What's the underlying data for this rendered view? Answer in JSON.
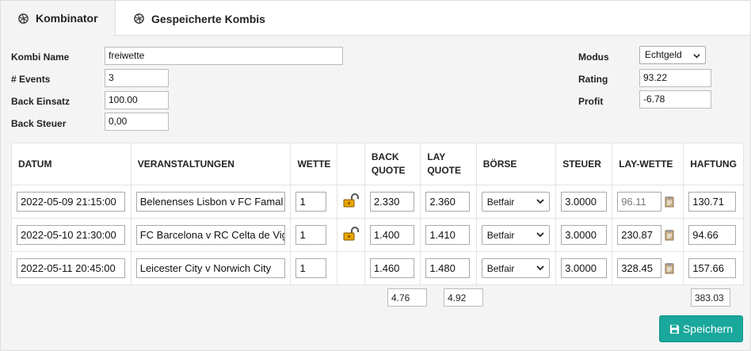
{
  "tabs": [
    {
      "label": "Kombinator",
      "icon": "dribbble-icon",
      "active": true
    },
    {
      "label": "Gespeicherte Kombis",
      "icon": "dribbble-icon",
      "active": false
    }
  ],
  "form": {
    "kombi_name_label": "Kombi Name",
    "kombi_name_value": "freiwette",
    "events_label": "# Events",
    "events_value": "3",
    "back_einsatz_label": "Back Einsatz",
    "back_einsatz_value": "100.00",
    "back_steuer_label": "Back Steuer",
    "back_steuer_value": "0,00",
    "modus_label": "Modus",
    "modus_value": "Echtgeld",
    "rating_label": "Rating",
    "rating_value": "93.22",
    "profit_label": "Profit",
    "profit_value": "-6.78"
  },
  "table": {
    "headers": {
      "datum": "DATUM",
      "veranstaltungen": "VERANSTALTUNGEN",
      "wette": "WETTE",
      "back_quote_1": "BACK",
      "back_quote_2": "QUOTE",
      "lay_quote_1": "LAY",
      "lay_quote_2": "QUOTE",
      "boerse": "BÖRSE",
      "steuer": "STEUER",
      "lay_wette": "LAY-WETTE",
      "haftung": "HAFTUNG"
    },
    "rows": [
      {
        "datum": "2022-05-09 21:15:00",
        "event": "Belenenses Lisbon v FC Famal",
        "wette": "1",
        "locked": true,
        "back": "2.330",
        "lay": "2.360",
        "boerse": "Betfair",
        "steuer": "3.0000",
        "lay_wette": "96.11",
        "lay_wette_readonly": true,
        "haftung": "130.71"
      },
      {
        "datum": "2022-05-10 21:30:00",
        "event": "FC Barcelona v RC Celta de Vig",
        "wette": "1",
        "locked": true,
        "back": "1.400",
        "lay": "1.410",
        "boerse": "Betfair",
        "steuer": "3.0000",
        "lay_wette": "230.87",
        "lay_wette_readonly": false,
        "haftung": "94.66"
      },
      {
        "datum": "2022-05-11 20:45:00",
        "event": "Leicester City v Norwich City",
        "wette": "1",
        "locked": false,
        "back": "1.460",
        "lay": "1.480",
        "boerse": "Betfair",
        "steuer": "3.0000",
        "lay_wette": "328.45",
        "lay_wette_readonly": false,
        "haftung": "157.66"
      }
    ],
    "totals": {
      "back": "4.76",
      "lay": "4.92",
      "haftung": "383.03"
    }
  },
  "save_button_label": "Speichern",
  "colors": {
    "accent": "#1aa79c",
    "lock": "#e8a400"
  }
}
